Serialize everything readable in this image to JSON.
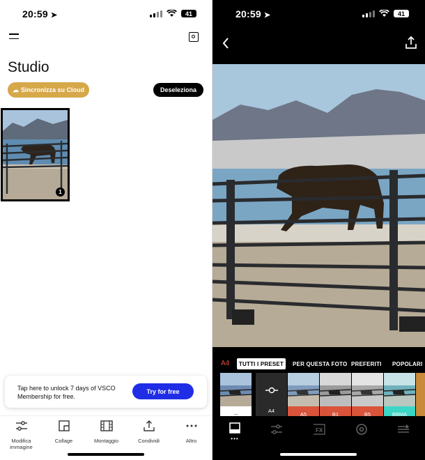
{
  "left": {
    "status": {
      "time": "20:59",
      "battery": "41"
    },
    "title": "Studio",
    "sync_button": "Sincronizza su Cloud",
    "deselect_button": "Deseleziona",
    "thumbnail_badge": "1",
    "promo": {
      "text": "Tap here to unlock 7 days of VSCO Membership for free.",
      "button": "Try for free"
    },
    "toolbar": [
      {
        "label": "Modifica immagine",
        "icon": "sliders-icon"
      },
      {
        "label": "Collage",
        "icon": "collage-icon"
      },
      {
        "label": "Montaggio",
        "icon": "film-icon"
      },
      {
        "label": "Condividi",
        "icon": "share-icon"
      },
      {
        "label": "Altro",
        "icon": "more-icon"
      }
    ]
  },
  "right": {
    "status": {
      "time": "20:59",
      "battery": "41"
    },
    "current_preset": "A4",
    "tabs": [
      "TUTTI I PRESET",
      "PER QUESTA FOTO",
      "PREFERITI",
      "POPOLARI"
    ],
    "presets": [
      {
        "label": "--",
        "color": "#ffffff"
      },
      {
        "label": "A4",
        "color": "#2a2a2a"
      },
      {
        "label": "A5",
        "color": "#d9543a"
      },
      {
        "label": "B1",
        "color": "#d9543a"
      },
      {
        "label": "B5",
        "color": "#d9543a"
      },
      {
        "label": "BBMA",
        "color": "#3bd6c6"
      }
    ],
    "bottom_icons": [
      "image-icon",
      "adjust-icon",
      "fx-icon",
      "history-icon",
      "favorites-list-icon"
    ]
  },
  "colors": {
    "accent_gold": "#d6a84a",
    "accent_blue": "#1f2ee6",
    "preset_red": "#d9543a"
  }
}
